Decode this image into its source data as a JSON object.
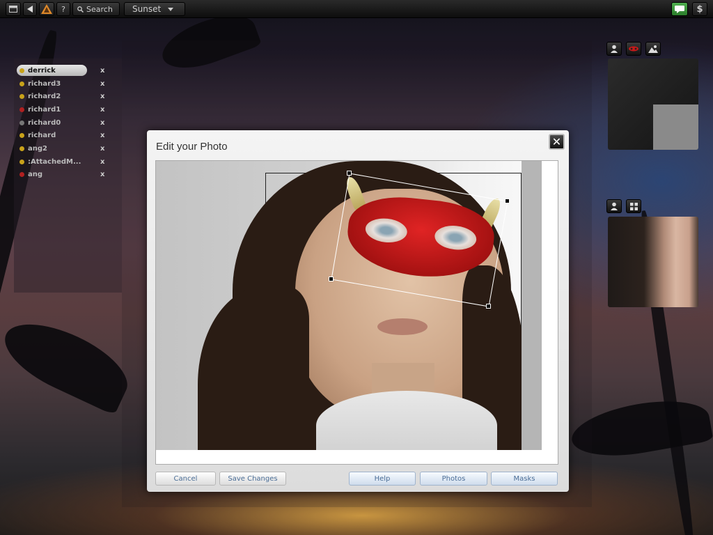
{
  "topbar": {
    "window_icon": "window-icon",
    "back_icon": "back-triangle-icon",
    "alert_icon": "warning-triangle-icon",
    "help_label": "?",
    "search_label": "Search",
    "location_label": "Sunset",
    "chat_icon": "chat-bubble-icon",
    "money_label": "$"
  },
  "users": {
    "items": [
      {
        "name": "derrick",
        "status_color": "#c8a21a",
        "selected": true,
        "remove_label": "x"
      },
      {
        "name": "richard3",
        "status_color": "#c8a21a",
        "remove_label": "x"
      },
      {
        "name": "richard2",
        "status_color": "#c8a21a",
        "remove_label": "x"
      },
      {
        "name": "richard1",
        "status_color": "#b02020",
        "remove_label": "x"
      },
      {
        "name": "richard0",
        "status_color": "#777777",
        "remove_label": "x"
      },
      {
        "name": "richard",
        "status_color": "#c8a21a",
        "remove_label": "x"
      },
      {
        "name": "ang2",
        "status_color": "#c8a21a",
        "remove_label": "x"
      },
      {
        "name": ":AttachedM...",
        "status_color": "#c8a21a",
        "remove_label": "x"
      },
      {
        "name": "ang",
        "status_color": "#b02020",
        "remove_label": "x"
      }
    ]
  },
  "right_panel": {
    "top_icons": [
      "person-icon",
      "red-mask-icon",
      "landscape-icon"
    ],
    "bottom_icons": [
      "person-icon",
      "grid-icon"
    ]
  },
  "dialog": {
    "title": "Edit your Photo",
    "close_label": "✕",
    "buttons": {
      "cancel": "Cancel",
      "save": "Save Changes",
      "help": "Help",
      "photos": "Photos",
      "masks": "Masks"
    }
  },
  "colors": {
    "accent_blue": "#4a6d96",
    "mask_red": "#c41a1a",
    "chat_green": "#3a9a3a"
  }
}
